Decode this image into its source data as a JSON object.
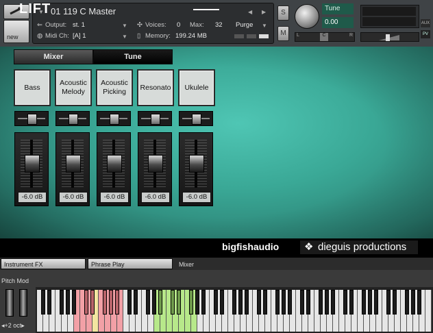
{
  "header": {
    "instrument_name": "01 119 C Master",
    "output_label": "Output:",
    "output_value": "st. 1",
    "midi_label": "Midi Ch:",
    "midi_value": "[A]  1",
    "voices_label": "Voices:",
    "voices_value": "0",
    "max_label": "Max:",
    "max_value": "32",
    "purge_label": "Purge",
    "memory_label": "Memory:",
    "memory_value": "199.24 MB",
    "new_label": "new",
    "s_label": "S",
    "m_label": "M",
    "tune_label": "Tune",
    "tune_value": "0.00",
    "pan_center": "C",
    "pan_left": "L",
    "pan_right": "R",
    "aux_label": "AUX",
    "pv_label": "PV"
  },
  "tabs": [
    {
      "label": "Mixer",
      "active": true
    },
    {
      "label": "Tune",
      "active": false
    }
  ],
  "channels": [
    {
      "name": "Bass",
      "db": "-6.0 dB"
    },
    {
      "name": "Acoustic Melody",
      "db": "-6.0 dB"
    },
    {
      "name": "Acoustic Picking",
      "db": "-6.0 dB"
    },
    {
      "name": "Resonato",
      "db": "-6.0 dB"
    },
    {
      "name": "Ukulele",
      "db": "-6.0 dB"
    }
  ],
  "footer": {
    "logo": "LIFT",
    "brand1": "bigfishaudio",
    "brand2": "dieguis productions"
  },
  "bottom_tabs": [
    {
      "label": "Instrument FX",
      "active": false
    },
    {
      "label": "Phrase Play",
      "active": false
    },
    {
      "label": "Mixer",
      "active": true
    }
  ],
  "keyboard": {
    "pitch_mod_label": "Pitch Mod",
    "octave_label": "◂+2 oct▸"
  },
  "colors": {
    "panel_teal": "#3aa896",
    "key_red": "#f2a0a6",
    "key_yellow": "#f3e6a0",
    "key_green": "#b7e88a"
  }
}
